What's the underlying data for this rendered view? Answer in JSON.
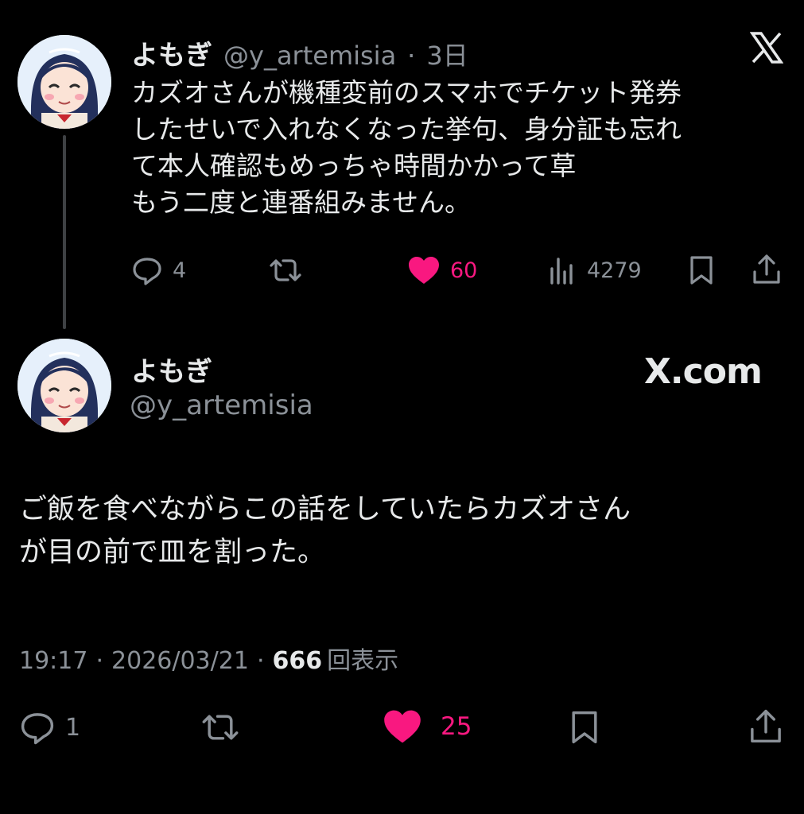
{
  "first_tweet": {
    "display_name": "よもぎ",
    "handle": "@y_artemisia",
    "time": "3日",
    "text": "カズオさんが機種変前のスマホでチケット発券\nしたせいで入れなくなった挙句、身分証も忘れ\nて本人確認もめっちゃ時間かかって草\nもう二度と連番組みません。",
    "replies": "4",
    "retweets": "",
    "likes": "60",
    "views": "4279"
  },
  "second_tweet": {
    "display_name": "よもぎ",
    "handle": "@y_artemisia",
    "brand": "X.com",
    "text": "ご飯を食べながらこの話をしていたらカズオさん\nが目の前で皿を割った。",
    "time": "19:17",
    "date": "2026/03/21",
    "views_count": "666",
    "views_label": "回表示",
    "replies": "1",
    "likes": "25"
  },
  "colors": {
    "background": "#000000",
    "text": "#e7e9ea",
    "muted": "#8b9198",
    "like": "#f91880"
  },
  "icons": [
    "x-logo-icon",
    "reply-icon",
    "retweet-icon",
    "heart-icon",
    "views-icon",
    "bookmark-icon",
    "share-icon"
  ]
}
